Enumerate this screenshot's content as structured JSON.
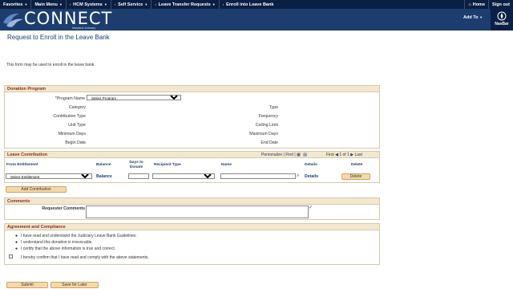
{
  "topnav": {
    "items": [
      "Favorites",
      "Main Menu",
      "HCM Systems",
      "Self Service",
      "Leave Transfer Requests",
      "Enroll into Leave Bank"
    ],
    "home": "Home",
    "signout": "Sign out"
  },
  "header": {
    "brand": "CONNECT",
    "brand_sub": "Maryland Judiciary",
    "add_to": "Add To",
    "navbar": "NavBar"
  },
  "page": {
    "title": "Request to Enroll in the Leave Bank",
    "intro": "This form may be used to enroll in the leave bank."
  },
  "donation": {
    "header": "Donation Program",
    "program_name_label": "*Program Name",
    "program_name_value": "Select Program",
    "left_labels": [
      "Category",
      "Contribution Type",
      "Unit Type",
      "Minimum Days",
      "Begin Date"
    ],
    "right_labels": [
      "Type",
      "Frequency",
      "Ceiling Limit",
      "Maximum Days",
      "End Date"
    ]
  },
  "contribution": {
    "header": "Leave Contribution",
    "personalize": "Personalize",
    "find": "Find",
    "first": "First",
    "page_info": "1 of 1",
    "last": "Last",
    "columns": [
      "From Entitlement",
      "Balance",
      "Days to Donate",
      "Recipient Type",
      "Name",
      "Details",
      "Delete"
    ],
    "row": {
      "entitlement": "Select Entitlement",
      "balance": "Balance",
      "details": "Details",
      "delete": "Delete"
    },
    "add_button": "Add Contribution"
  },
  "comments": {
    "header": "Comments",
    "label": "Requester Comments"
  },
  "agreement": {
    "header": "Agreement and Compliance",
    "statements": [
      "I have read and understand the Judiciary Leave Bank Guidelines.",
      "I understand this donation is irrevocable.",
      "I certify that the above information is true and correct."
    ],
    "confirm": "I hereby confirm that I have read and comply with the above statements."
  },
  "actions": {
    "submit": "Submit",
    "save": "Save for Later"
  },
  "colors": {
    "nav_bg": "#0a1f44",
    "header_bg": "#1c3d6e",
    "section_header_bg": "#f3e7cf",
    "section_title": "#8a2c1b",
    "button_bg": "#f6d9a8"
  }
}
